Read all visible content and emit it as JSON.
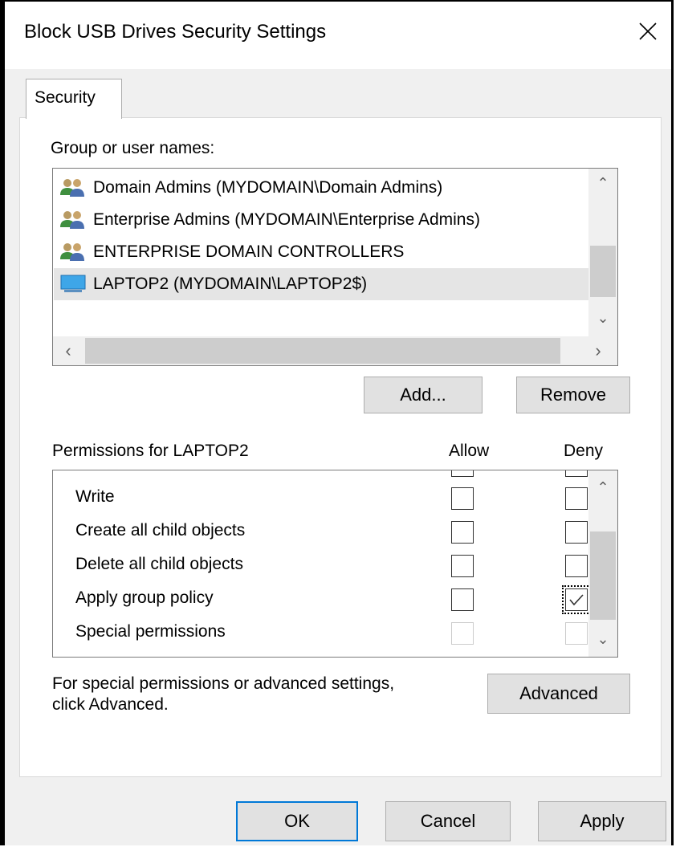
{
  "window": {
    "title": "Block USB Drives Security Settings",
    "close_glyph": "✕"
  },
  "tabs": [
    {
      "label": "Security"
    }
  ],
  "groups": {
    "label": "Group or user names:",
    "items": [
      {
        "name": "Domain Admins (MYDOMAIN\\Domain Admins)",
        "icon": "users-group-icon",
        "selected": false
      },
      {
        "name": "Enterprise Admins (MYDOMAIN\\Enterprise Admins)",
        "icon": "users-group-icon",
        "selected": false
      },
      {
        "name": "ENTERPRISE DOMAIN CONTROLLERS",
        "icon": "users-group-icon",
        "selected": false
      },
      {
        "name": "LAPTOP2 (MYDOMAIN\\LAPTOP2$)",
        "icon": "computer-monitor-icon",
        "selected": true
      }
    ]
  },
  "buttons": {
    "add": "Add...",
    "remove": "Remove",
    "advanced": "Advanced",
    "ok": "OK",
    "cancel": "Cancel",
    "apply": "Apply"
  },
  "permissions": {
    "label": "Permissions for LAPTOP2",
    "allow_header": "Allow",
    "deny_header": "Deny",
    "rows": [
      {
        "name": "Write",
        "allow": false,
        "deny": false
      },
      {
        "name": "Create all child objects",
        "allow": false,
        "deny": false
      },
      {
        "name": "Delete all child objects",
        "allow": false,
        "deny": false
      },
      {
        "name": "Apply group policy",
        "allow": false,
        "deny": true
      },
      {
        "name": "Special permissions",
        "allow": false,
        "deny": false,
        "disabled": true
      }
    ]
  },
  "advanced_note": {
    "line1": "For special permissions or advanced settings,",
    "line2": "click Advanced."
  },
  "colors": {
    "accent": "#0078d7",
    "selection": "#e5e5e5",
    "dialog_bg": "#f0f0f0"
  }
}
